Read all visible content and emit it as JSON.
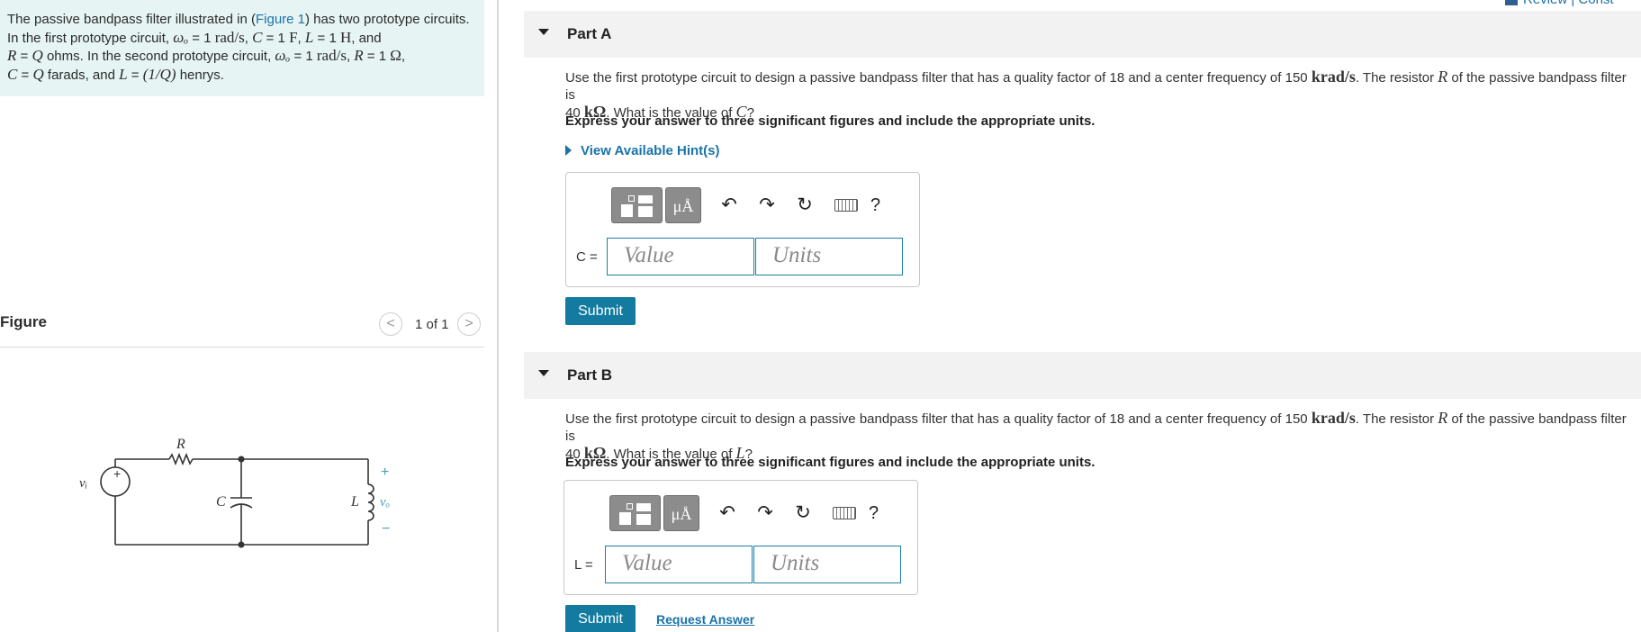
{
  "intro": {
    "t1": "The passive bandpass filter illustrated in (",
    "figure_link": "Figure 1",
    "t2": ") has two prototype circuits.",
    "t3": "In the first prototype circuit, ",
    "w0": "ωₒ",
    "t4": " = 1 ",
    "rad_s": "rad/s",
    "t5": ", ",
    "C": "C",
    "t6": " = 1 ",
    "F": "F",
    "t7": ", ",
    "L": "L",
    "t8": " = 1 ",
    "H": "H",
    "t9": ", and",
    "R": "R",
    "t10": " = ",
    "Q": "Q",
    "t11": " ohms. In the second prototype circuit, ",
    "t12": " = 1 ",
    "t13": ", ",
    "t14": " = 1 ",
    "ohm": "Ω",
    "t15": ",",
    "t16": " = ",
    "t17": " farads, and ",
    "t18": " = ",
    "oneoverq": "(1/Q)",
    "t19": " henrys."
  },
  "figure": {
    "title": "Figure",
    "prev": "<",
    "next": ">",
    "pager": "1 of 1",
    "circuit_labels": {
      "R": "R",
      "C": "C",
      "L": "L",
      "vi": "vᵢ",
      "vo": "vₒ",
      "plus": "+",
      "minus": "−",
      "src_plus": "+"
    }
  },
  "review_link": "Review | Const",
  "partA": {
    "title": "Part A",
    "q1": "Use the first prototype circuit to design a passive bandpass filter that has a quality factor of 18 and a center frequency of 150 ",
    "unit": "krad/s",
    "q2": ". The resistor ",
    "R": "R",
    "q3": " of the passive bandpass filter is",
    "q4": "40 ",
    "kohm": "kΩ",
    "q5": ". What is the value of ",
    "target": "C",
    "q6": "?",
    "instructions": "Express your answer to three significant figures and include the appropriate units.",
    "hint": "View Available Hint(s)",
    "var_label": "C =",
    "value_placeholder": "Value",
    "units_placeholder": "Units",
    "submit": "Submit"
  },
  "partB": {
    "title": "Part B",
    "q1": "Use the first prototype circuit to design a passive bandpass filter that has a quality factor of 18 and a center frequency of 150 ",
    "unit": "krad/s",
    "q2": ". The resistor ",
    "R": "R",
    "q3": " of the passive bandpass filter is",
    "q4": "40 ",
    "kohm": "kΩ",
    "q5": ". What is the value of ",
    "target": "L",
    "q6": "?",
    "instructions": "Express your answer to three significant figures and include the appropriate units.",
    "var_label": "L =",
    "value_placeholder": "Value",
    "units_placeholder": "Units",
    "submit": "Submit",
    "request_answer": "Request Answer"
  },
  "toolbar": {
    "mu": "μÅ",
    "undo": "↶",
    "redo": "↷",
    "reset": "↻",
    "help": "?"
  },
  "icons": [
    "templates-icon",
    "units-icon",
    "undo-icon",
    "redo-icon",
    "reset-icon",
    "keyboard-icon",
    "help-icon",
    "caret-down-icon",
    "caret-right-icon",
    "chevron-left-icon",
    "chevron-right-icon"
  ]
}
